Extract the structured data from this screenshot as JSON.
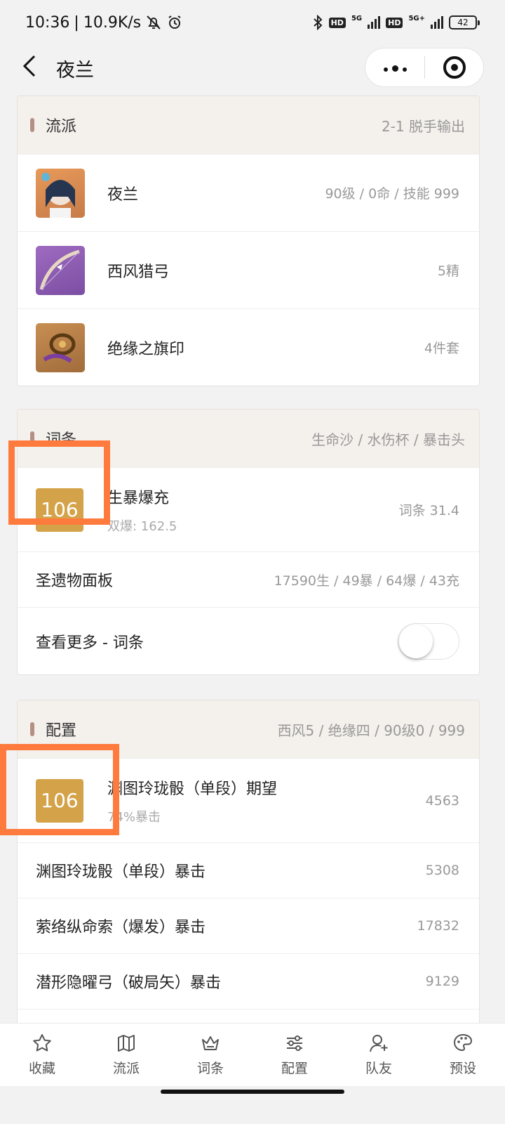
{
  "status_bar": {
    "time": "10:36",
    "speed": "10.9K/s",
    "network1": "5G",
    "network2": "5G+",
    "hd": "HD",
    "battery": "42"
  },
  "nav": {
    "title": "夜兰"
  },
  "genre_card": {
    "title": "流派",
    "info": "2-1 脱手输出",
    "items": [
      {
        "name": "夜兰",
        "detail": "90级 / 0命 / 技能 999"
      },
      {
        "name": "西风猎弓",
        "detail": "5精"
      },
      {
        "name": "绝缘之旗印",
        "detail": "4件套"
      }
    ]
  },
  "stats_card": {
    "title": "词条",
    "info": "生命沙 / 水伤杯 / 暴击头",
    "score": {
      "badge": "106",
      "title": "生暴爆充",
      "subtitle": "双爆: 162.5",
      "value": "词条 31.4"
    },
    "panel": {
      "label": "圣遗物面板",
      "value": "17590生 / 49暴 / 64爆 / 43充"
    },
    "more": {
      "label": "查看更多 - 词条",
      "enabled": false
    }
  },
  "config_card": {
    "title": "配置",
    "info": "西风5 / 绝缘四 / 90级0 / 999",
    "score": {
      "badge": "106",
      "title": "渊图玲珑骰（单段）期望",
      "subtitle": "74%暴击",
      "value": "4563"
    },
    "rows": [
      {
        "label": "渊图玲珑骰（单段）暴击",
        "value": "5308"
      },
      {
        "label": "萦络纵命索（爆发）暴击",
        "value": "17832"
      },
      {
        "label": "潜形隐曜弓（破局矢）暴击",
        "value": "9129"
      }
    ]
  },
  "tab_bar": {
    "tabs": [
      {
        "label": "收藏",
        "icon": "star-icon"
      },
      {
        "label": "流派",
        "icon": "map-icon"
      },
      {
        "label": "词条",
        "icon": "crown-icon"
      },
      {
        "label": "配置",
        "icon": "sliders-icon"
      },
      {
        "label": "队友",
        "icon": "user-add-icon"
      },
      {
        "label": "预设",
        "icon": "palette-icon"
      }
    ]
  },
  "colors": {
    "accent_bar": "#b48f84",
    "score_badge": "#d4a349",
    "highlight": "#ff7a3d",
    "header_bg": "#f4f0ec"
  }
}
